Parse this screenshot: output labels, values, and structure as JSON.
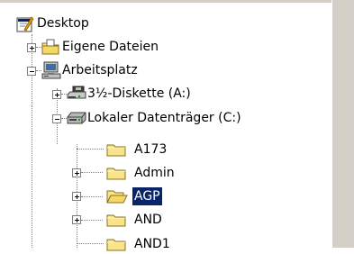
{
  "tree": {
    "root": {
      "label": "Desktop",
      "icon": "desktop-icon"
    },
    "items": [
      {
        "label": "Eigene Dateien",
        "icon": "my-documents-folder-icon",
        "expander": "plus"
      },
      {
        "label": "Arbeitsplatz",
        "icon": "my-computer-icon",
        "expander": "minus"
      },
      {
        "label": "3½-Diskette (A:)",
        "icon": "floppy-drive-icon",
        "expander": "plus"
      },
      {
        "label": "Lokaler Datenträger (C:)",
        "icon": "hard-drive-icon",
        "expander": "minus"
      },
      {
        "label": "A173",
        "icon": "folder-icon",
        "expander": "none"
      },
      {
        "label": "Admin",
        "icon": "folder-icon",
        "expander": "plus"
      },
      {
        "label": "AGP",
        "icon": "open-folder-icon",
        "expander": "plus",
        "selected": true
      },
      {
        "label": "AND",
        "icon": "folder-icon",
        "expander": "plus"
      },
      {
        "label": "AND1",
        "icon": "folder-icon",
        "expander": "none"
      }
    ]
  },
  "colors": {
    "selection": "#0a246a",
    "folder": "#f9e48a",
    "chrome": "#d4d0c8"
  }
}
